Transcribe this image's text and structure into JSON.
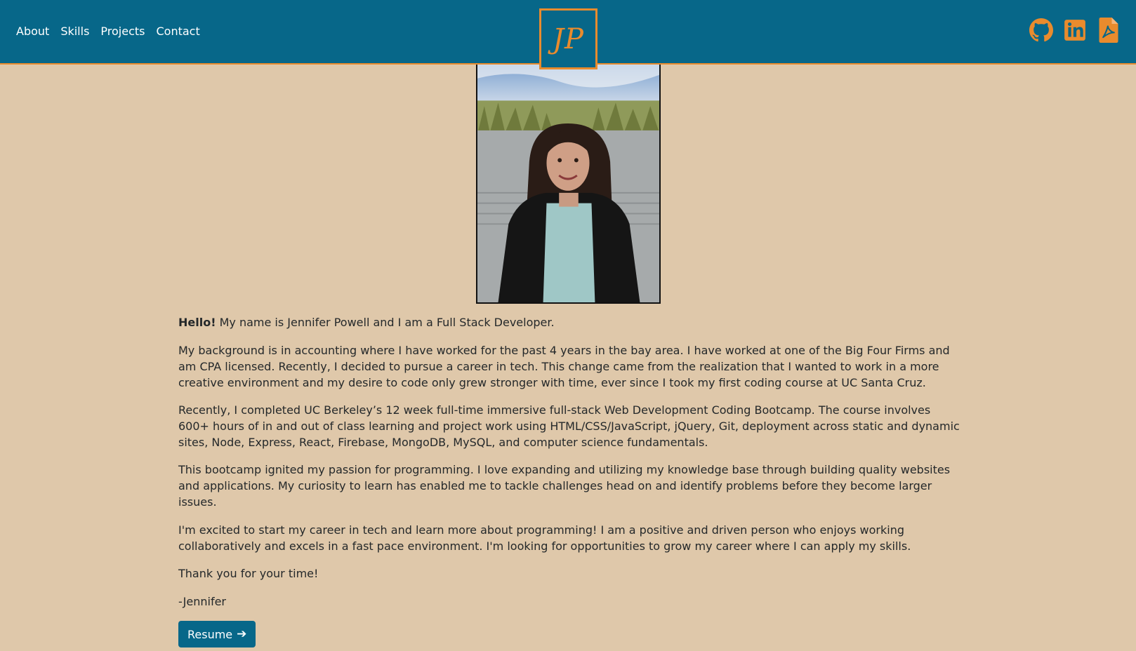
{
  "nav": {
    "links": [
      "About",
      "Skills",
      "Projects",
      "Contact"
    ],
    "brand": "JP"
  },
  "social": [
    {
      "icon": "github-icon"
    },
    {
      "icon": "linkedin-icon"
    },
    {
      "icon": "pdf-icon"
    }
  ],
  "colors": {
    "navbar": "#076789",
    "accent": "#e98b2d",
    "background": "#dfc8aa",
    "button": "#076789"
  },
  "about": {
    "greeting_bold": "Hello!",
    "greeting_rest": " My name is Jennifer Powell and I am a Full Stack Developer.",
    "p1": "My background is in accounting where I have worked for the past 4 years in the bay area. I have worked at one of the Big Four Firms and am CPA licensed. Recently, I decided to pursue a career in tech. This change came from the realization that I wanted to work in a more creative environment and my desire to code only grew stronger with time, ever since I took my first coding course at UC Santa Cruz.",
    "p2": "Recently, I completed UC Berkeley’s 12 week full-time immersive full-stack Web Development Coding Bootcamp. The course involves 600+ hours of in and out of class learning and project work using HTML/CSS/JavaScript, jQuery, Git, deployment across static and dynamic sites, Node, Express, React, Firebase, MongoDB, MySQL, and computer science fundamentals.",
    "p3": "This bootcamp ignited my passion for programming. I love expanding and utilizing my knowledge base through building quality websites and applications. My curiosity to learn has enabled me to tackle challenges head on and identify problems before they become larger issues.",
    "p4": "I'm excited to start my career in tech and learn more about programming! I am a positive and driven person who enjoys working collaboratively and excels in a fast pace environment. I'm looking for opportunities to grow my career where I can apply my skills.",
    "thanks": "Thank you for your time!",
    "signature": "-Jennifer",
    "resume_label": "Resume"
  }
}
